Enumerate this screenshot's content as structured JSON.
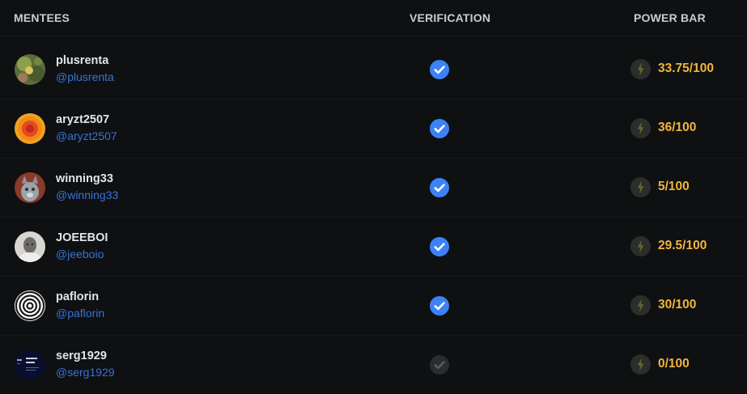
{
  "header": {
    "mentees": "MENTEES",
    "verification": "VERIFICATION",
    "power_bar": "POWER BAR"
  },
  "mentees": [
    {
      "username": "plusrenta",
      "handle": "@plusrenta",
      "verified": true,
      "power": "33.75/100",
      "power_value": 33.75
    },
    {
      "username": "aryzt2507",
      "handle": "@aryzt2507",
      "verified": true,
      "power": "36/100",
      "power_value": 36
    },
    {
      "username": "winning33",
      "handle": "@winning33",
      "verified": true,
      "power": "5/100",
      "power_value": 5
    },
    {
      "username": "JOEEBOI",
      "handle": "@jeeboio",
      "verified": true,
      "power": "29.5/100",
      "power_value": 29.5
    },
    {
      "username": "paflorin",
      "handle": "@paflorin",
      "verified": true,
      "power": "30/100",
      "power_value": 30
    },
    {
      "username": "serg1929",
      "handle": "@serg1929",
      "verified": false,
      "power": "0/100",
      "power_value": 0
    }
  ],
  "icons": {
    "verified": "verified-check-icon",
    "unverified": "unverified-check-icon",
    "power": "lightning-bolt-icon"
  },
  "colors": {
    "background": "#0e1012",
    "handle": "#3b72d6",
    "power_text": "#f2b43c",
    "verified": "#3b82f6",
    "unverified": "#2a2c30"
  }
}
